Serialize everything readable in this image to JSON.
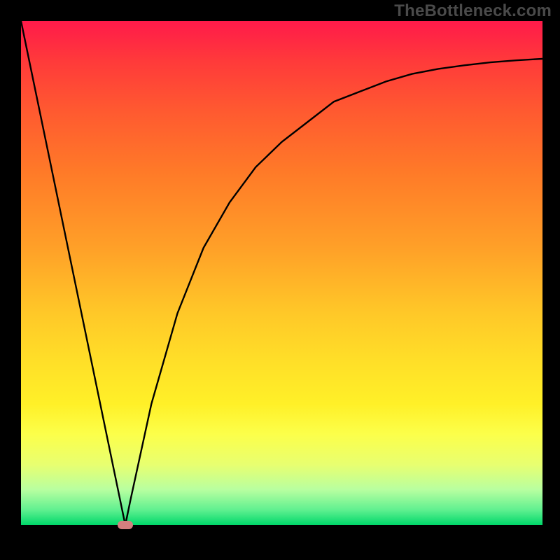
{
  "watermark": "TheBottleneck.com",
  "colors": {
    "page_bg": "#000000",
    "watermark": "#4a4a4a",
    "curve": "#000000",
    "marker": "#d47f7f",
    "gradient_top": "#ff1a4a",
    "gradient_bottom": "#00d86a"
  },
  "chart_data": {
    "type": "line",
    "x": [
      0,
      5,
      10,
      15,
      19,
      20,
      21,
      25,
      30,
      35,
      40,
      45,
      50,
      55,
      60,
      65,
      70,
      75,
      80,
      85,
      90,
      95,
      100
    ],
    "values": [
      100,
      75,
      50,
      25,
      5,
      0,
      5,
      24,
      42,
      55,
      64,
      71,
      76,
      80,
      84,
      86,
      88,
      89.5,
      90.5,
      91.2,
      91.8,
      92.2,
      92.5
    ],
    "title": "",
    "xlabel": "",
    "ylabel": "",
    "xlim": [
      0,
      100
    ],
    "ylim": [
      0,
      100
    ],
    "marker": {
      "x": 20,
      "y": 0
    }
  }
}
